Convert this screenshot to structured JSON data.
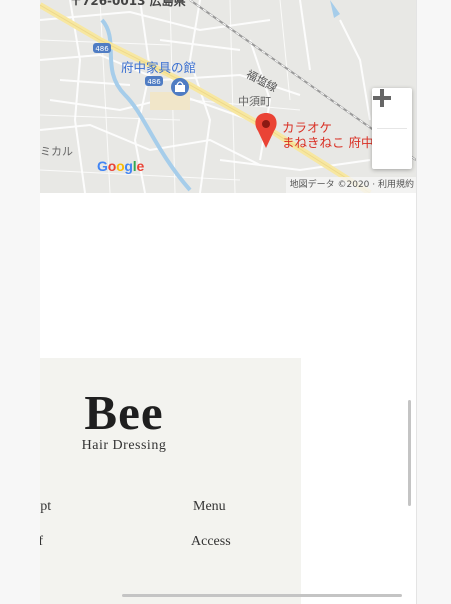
{
  "map": {
    "postal_label": "〒726-0013 広島県",
    "store_label": "府中家具の館",
    "town_label": "中須町",
    "railway_label": "福塩線",
    "left_label": "ミカル",
    "route_badges": [
      "486",
      "486"
    ],
    "poi_line1": "カラオケ",
    "poi_line2": "まねきねこ 府中",
    "google_logo_letters": [
      "G",
      "o",
      "o",
      "g",
      "l",
      "e"
    ],
    "attribution": "地図データ ©2020 · 利用規約",
    "zoom_in": "+",
    "zoom_out": "−",
    "icons": {
      "pin": "map-pin-icon",
      "shop": "shopping-bag-icon"
    },
    "colors": {
      "pin": "#ea4335",
      "road_major": "#f7e7a1",
      "water": "#a6cdea",
      "store_text": "#3a6fd1"
    }
  },
  "footer": {
    "brand": "Bee",
    "brand_sub": "Hair Dressing",
    "links": {
      "concept": "ept",
      "menu": "Menu",
      "staff": "ff",
      "access": "Access"
    }
  }
}
